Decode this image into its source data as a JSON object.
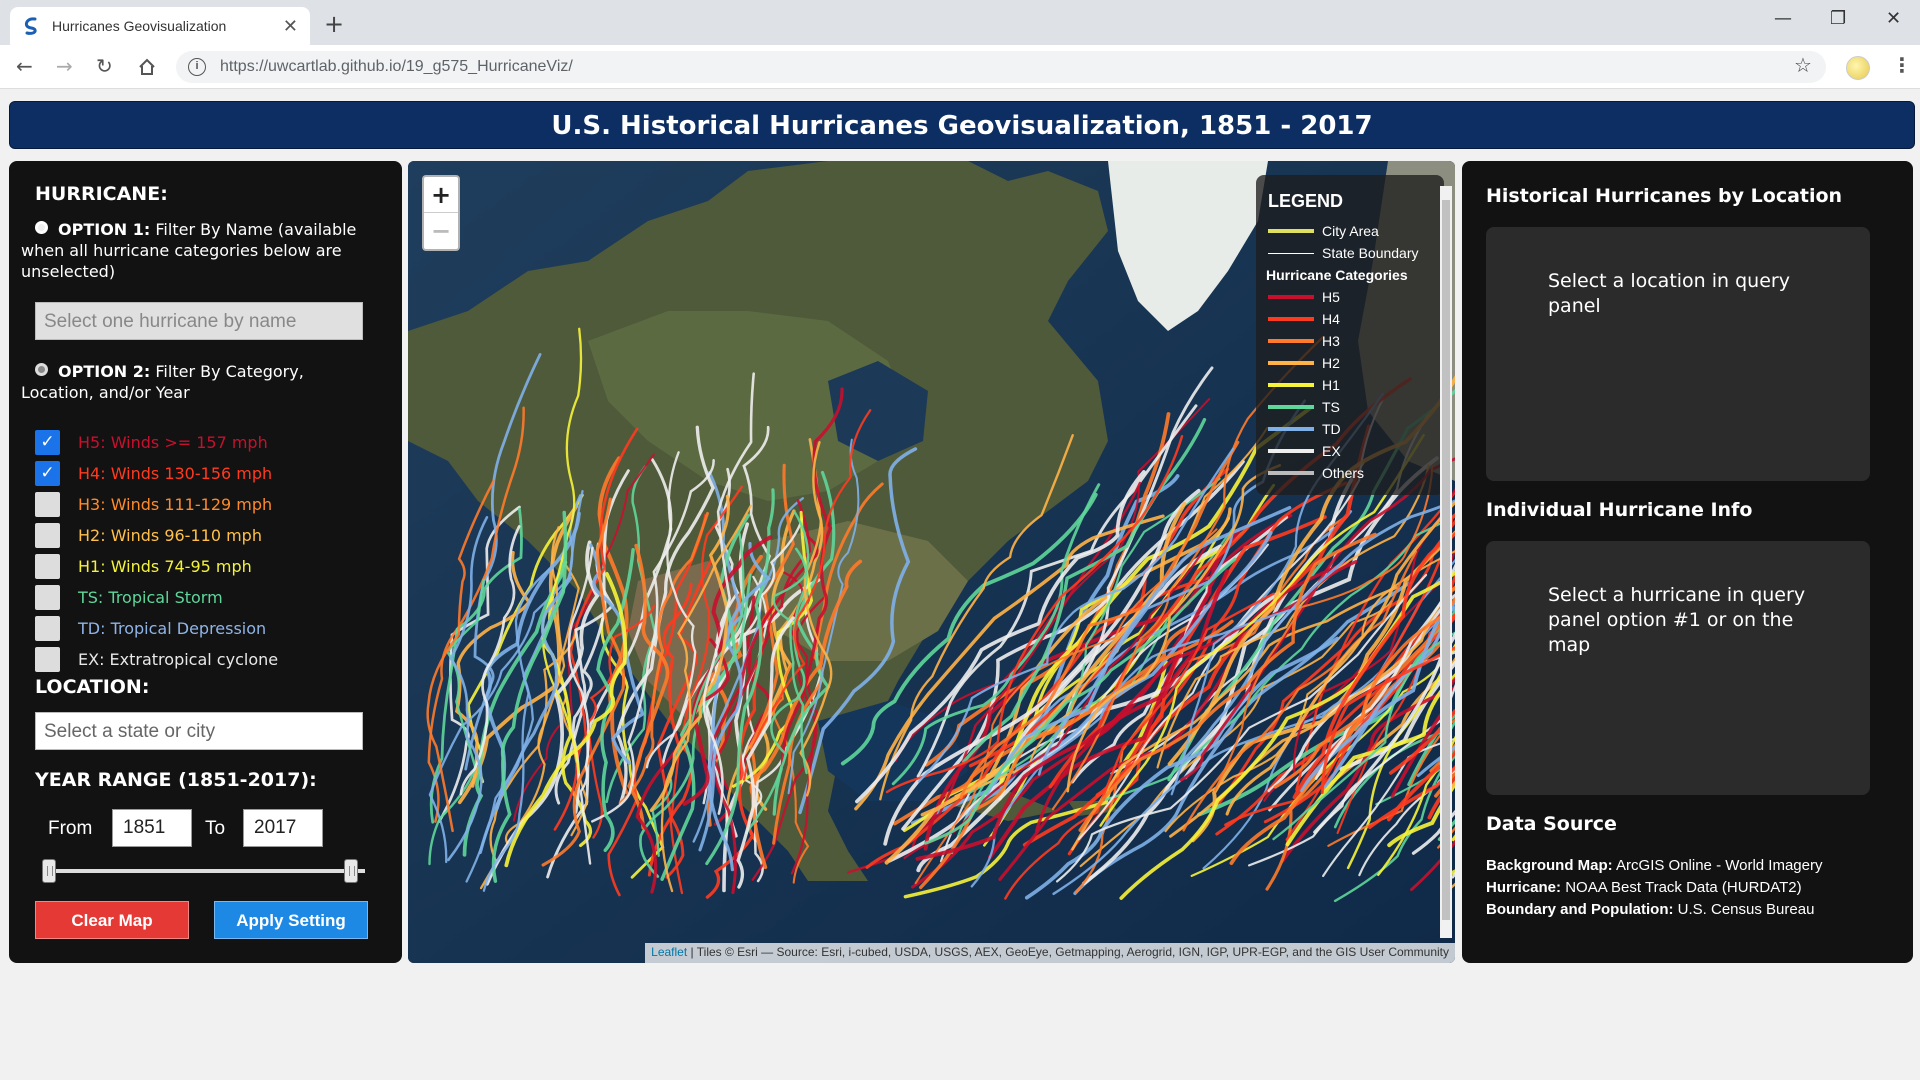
{
  "browser": {
    "tab_title": "Hurricanes Geovisualization",
    "url": "https://uwcartlab.github.io/19_g575_HurricaneViz/"
  },
  "page": {
    "title": "U.S. Historical Hurricanes Geovisualization, 1851 - 2017"
  },
  "left": {
    "hurricane_title": "HURRICANE:",
    "option1_bold": "OPTION 1:",
    "option1_text": "Filter By Name (available when all hurricane categories below are unselected)",
    "name_placeholder": "Select one hurricane by name",
    "option2_bold": "OPTION 2:",
    "option2_text": "Filter By Category, Location, and/or Year",
    "categories": [
      {
        "label": "H5: Winds >= 157 mph",
        "checked": true,
        "color": "#c8102e"
      },
      {
        "label": "H4: Winds 130-156 mph",
        "checked": true,
        "color": "#ff3b1f"
      },
      {
        "label": "H3: Winds 111-129 mph",
        "checked": false,
        "color": "#ff8a2a"
      },
      {
        "label": "H2: Winds 96-110 mph",
        "checked": false,
        "color": "#ffc04a"
      },
      {
        "label": "H1: Winds 74-95 mph",
        "checked": false,
        "color": "#f4f33a"
      },
      {
        "label": "TS: Tropical Storm",
        "checked": false,
        "color": "#5fd69a"
      },
      {
        "label": "TD: Tropical Depression",
        "checked": false,
        "color": "#8fb5e8"
      },
      {
        "label": "EX: Extratropical cyclone",
        "checked": false,
        "color": "#e8e8e8"
      }
    ],
    "location_title": "LOCATION:",
    "location_placeholder": "Select a state or city",
    "year_title": "YEAR RANGE (1851-2017):",
    "from_label": "From",
    "to_label": "To",
    "from_value": "1851",
    "to_value": "2017",
    "clear_label": "Clear Map",
    "apply_label": "Apply Setting"
  },
  "map": {
    "zoom_in": "+",
    "zoom_out": "−",
    "legend_title": "LEGEND",
    "legend_items": [
      {
        "label": "City Area",
        "color": "#e0e060"
      },
      {
        "label": "State Boundary",
        "color": "#ffffff"
      }
    ],
    "legend_categories_title": "Hurricane Categories",
    "legend_categories": [
      {
        "label": "H5",
        "color": "#c8102e"
      },
      {
        "label": "H4",
        "color": "#ff3b1f"
      },
      {
        "label": "H3",
        "color": "#ff7a2a"
      },
      {
        "label": "H2",
        "color": "#ffb347"
      },
      {
        "label": "H1",
        "color": "#f7f33a"
      },
      {
        "label": "TS",
        "color": "#5fd69a"
      },
      {
        "label": "TD",
        "color": "#7fb0e8"
      },
      {
        "label": "EX",
        "color": "#eeeeee"
      },
      {
        "label": "Others",
        "color": "#bbbbbb"
      }
    ],
    "attribution_link": "Leaflet",
    "attribution_text": "| Tiles © Esri — Source: Esri, i-cubed, USDA, USGS, AEX, GeoEye, Getmapping, Aerogrid, IGN, IGP, UPR-EGP, and the GIS User Community"
  },
  "right": {
    "location_title": "Historical Hurricanes by Location",
    "location_msg": "Select a location in query panel",
    "individual_title": "Individual Hurricane Info",
    "individual_msg": "Select a hurricane in query panel option #1 or on the map",
    "source_title": "Data Source",
    "sources": [
      {
        "key": "Background Map:",
        "value": "ArcGIS Online - World Imagery"
      },
      {
        "key": "Hurricane:",
        "value": "NOAA Best Track Data (HURDAT2)"
      },
      {
        "key": "Boundary and Population:",
        "value": "U.S. Census Bureau"
      }
    ]
  }
}
